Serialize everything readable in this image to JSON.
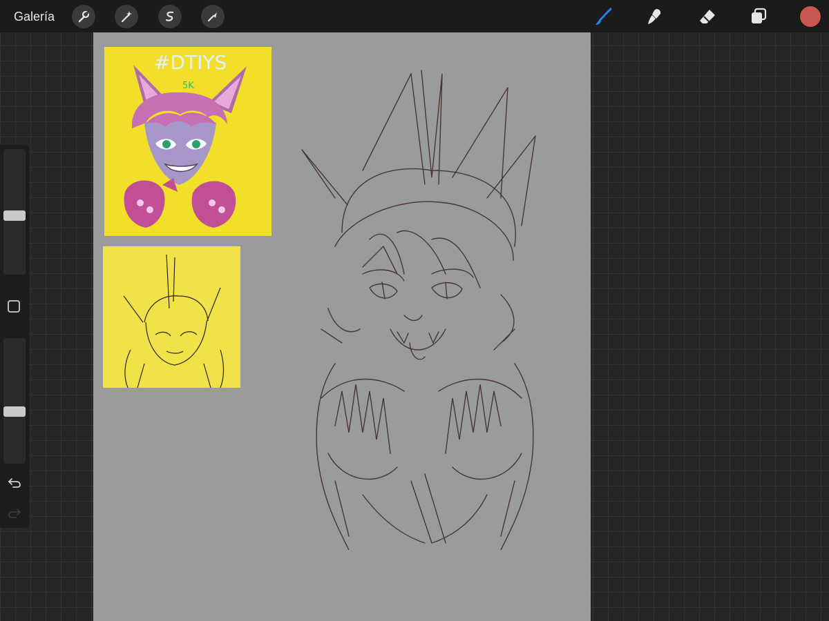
{
  "toolbar": {
    "gallery_label": "Galería",
    "left_tools": [
      "wrench-icon",
      "magic-wand-icon",
      "selection-icon",
      "transform-arrow-icon"
    ],
    "right_tools": [
      "brush-icon",
      "smudge-icon",
      "eraser-icon",
      "layers-icon"
    ],
    "active_tool": "brush-icon",
    "active_tool_color": "#2f7df6",
    "current_color": "#c8584f"
  },
  "sidebar": {
    "brush_size_level": 0.47,
    "opacity_level": 0.41,
    "modify_button": "square-icon",
    "undo": "undo-icon",
    "redo": "redo-icon"
  },
  "canvas": {
    "background": "#9a9b9c",
    "reference_1": {
      "background": "#f2df2a",
      "handwritten_text": "#DTIYS",
      "handwritten_subtext": "5K"
    },
    "reference_2": {
      "background": "#f1e24a"
    },
    "sketch_color": "#4a3535"
  }
}
